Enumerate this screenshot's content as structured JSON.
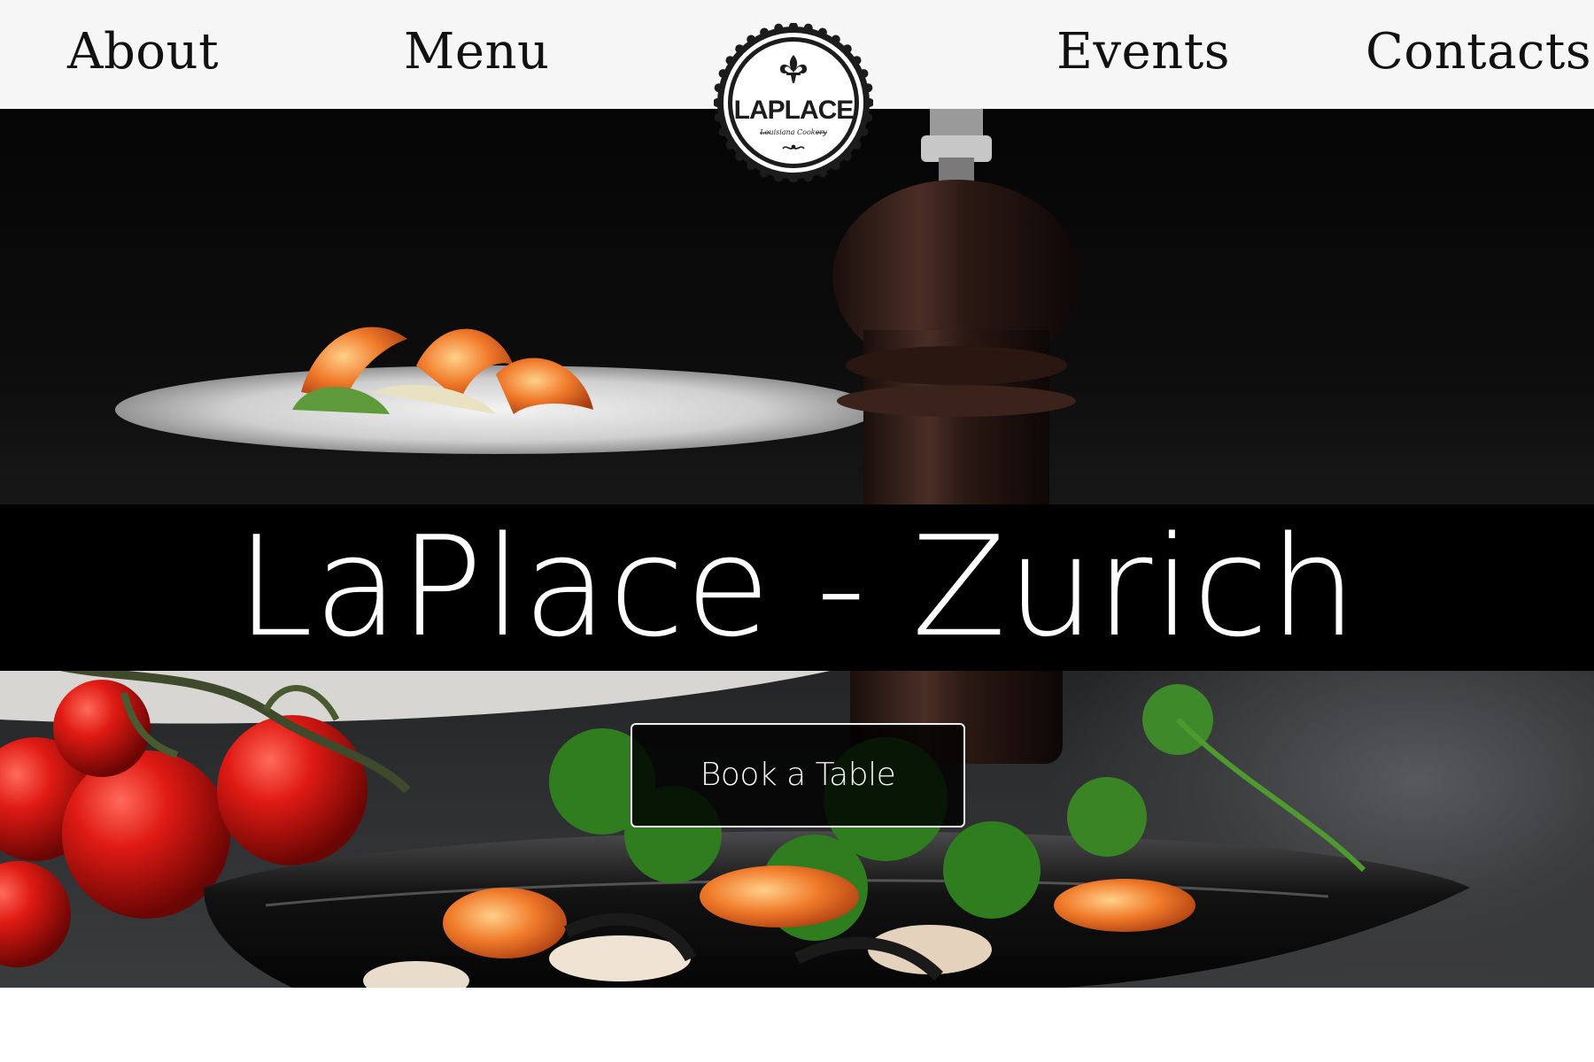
{
  "nav": {
    "items": [
      {
        "label": "About"
      },
      {
        "label": "Menu"
      },
      {
        "label": "Events"
      },
      {
        "label": "Contacts"
      }
    ]
  },
  "logo": {
    "name": "LAPLACE",
    "tagline": "Louisiana Cookery",
    "icon": "fleur-de-lis-icon"
  },
  "hero": {
    "title": "LaPlace - Zurich",
    "cta_label": "Book a Table"
  },
  "colors": {
    "nav_background": "#f6f6f6",
    "nav_text": "#111111",
    "title_band": "#000000",
    "title_text": "#ffffff",
    "cta_border": "#f2f2f2"
  }
}
